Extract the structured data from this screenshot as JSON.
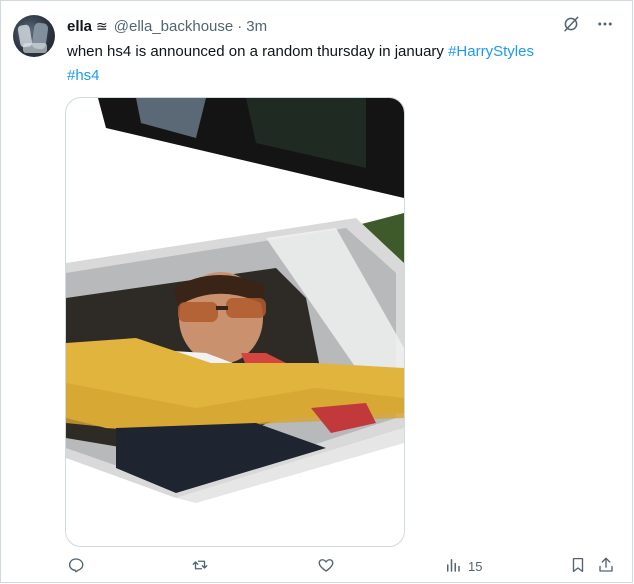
{
  "tweet": {
    "display_name": "ella",
    "name_emoji": "≊",
    "handle": "@ella_backhouse",
    "separator": "·",
    "time": "3m",
    "text_plain": "when hs4 is announced on a random thursday in january ",
    "hashtags": [
      "#HarryStyles",
      "#hs4"
    ]
  },
  "actions": {
    "replies_icon": "reply-icon",
    "retweet_icon": "retweet-icon",
    "like_icon": "heart-icon",
    "views_icon": "views-icon",
    "views_count": "15",
    "bookmark_icon": "bookmark-icon",
    "share_icon": "share-icon"
  },
  "colors": {
    "link": "#1d9bf0",
    "muted": "#536471",
    "border": "#cfd9de"
  }
}
